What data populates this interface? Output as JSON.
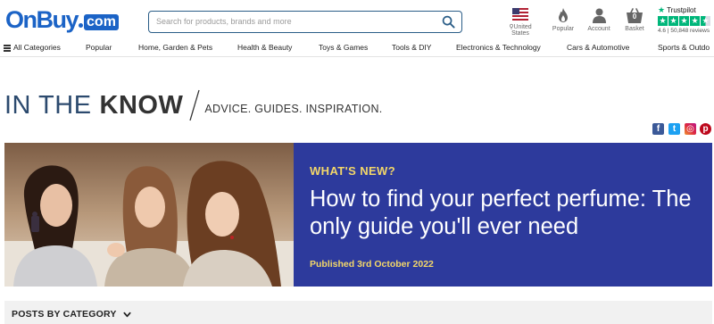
{
  "brand": {
    "name_on": "OnBuy",
    "name_com": "com"
  },
  "search": {
    "placeholder": "Search for products, brands and more"
  },
  "header_icons": {
    "location": "United States",
    "popular": "Popular",
    "account": "Account",
    "basket": "Basket",
    "basket_count": "0"
  },
  "trustpilot": {
    "logo": "Trustpilot",
    "rating": "4.6",
    "reviews": "50,848 reviews"
  },
  "nav": {
    "all_categories": "All Categories",
    "items": [
      "Popular",
      "Home, Garden & Pets",
      "Health & Beauty",
      "Toys & Games",
      "Tools & DIY",
      "Electronics & Technology",
      "Cars & Automotive",
      "Sports & Outdo"
    ]
  },
  "page_title": {
    "part1": "IN THE",
    "part2": "KNOW",
    "tagline": "ADVICE. GUIDES. INSPIRATION."
  },
  "social": {
    "facebook": "f",
    "twitter": "t",
    "instagram": "◎",
    "pinterest": "p"
  },
  "hero": {
    "kicker": "WHAT'S NEW?",
    "title": "How to find your perfect perfume: The only guide you'll ever need",
    "date": "Published 3rd October 2022"
  },
  "posts": {
    "label": "POSTS BY CATEGORY"
  },
  "colors": {
    "brand_blue": "#1b63c6",
    "hero_bg": "#2d3a9c",
    "accent_yellow": "#f3d769",
    "trustpilot_green": "#00b67a"
  },
  "icons": [
    "search-icon",
    "flag-icon",
    "location-pin-icon",
    "flame-icon",
    "user-icon",
    "basket-icon",
    "menu-icon",
    "facebook-icon",
    "twitter-icon",
    "instagram-icon",
    "pinterest-icon",
    "chevron-down-icon"
  ]
}
